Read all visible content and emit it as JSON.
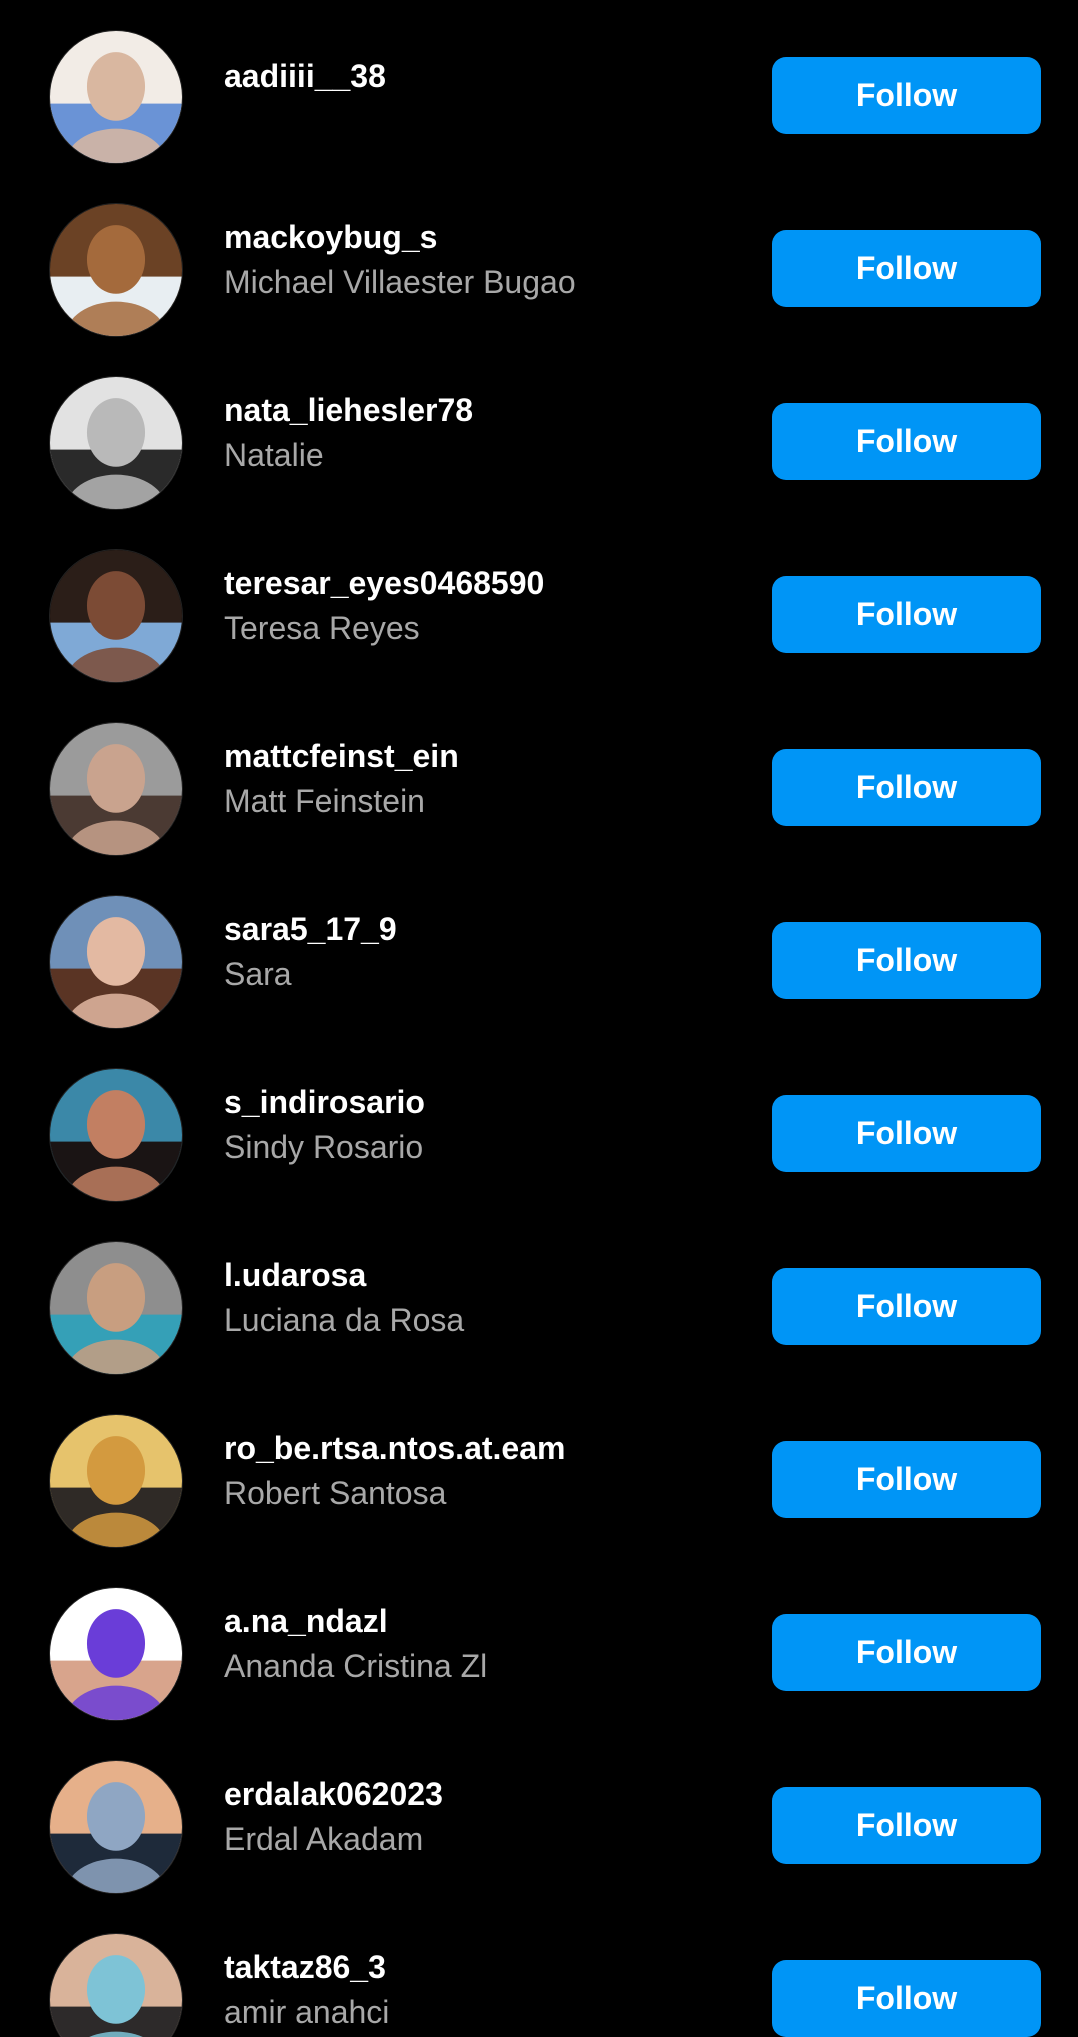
{
  "colors": {
    "background": "#000000",
    "follow_button": "#0095f6",
    "username": "#ffffff",
    "fullname": "#a8a8a8"
  },
  "accounts": [
    {
      "username": "aadiiii__38",
      "fullname": "",
      "follow_label": "Follow",
      "avatar_colors": [
        "#d9b7a0",
        "#6a93d6",
        "#f2ece6"
      ]
    },
    {
      "username": "mackoybug_s",
      "fullname": "Michael Villaester Bugao",
      "follow_label": "Follow",
      "avatar_colors": [
        "#a46a3c",
        "#e8eef2",
        "#6b4225"
      ]
    },
    {
      "username": "nata_liehesler78",
      "fullname": "Natalie",
      "follow_label": "Follow",
      "avatar_colors": [
        "#b9b9b9",
        "#2a2a2a",
        "#e2e2e2"
      ]
    },
    {
      "username": "teresar_eyes0468590",
      "fullname": "Teresa Reyes",
      "follow_label": "Follow",
      "avatar_colors": [
        "#7c4b35",
        "#7fa9d6",
        "#2b1e18"
      ]
    },
    {
      "username": "mattcfeinst_ein",
      "fullname": "Matt Feinstein",
      "follow_label": "Follow",
      "avatar_colors": [
        "#c9a38e",
        "#4b3a33",
        "#9b9b9b"
      ]
    },
    {
      "username": "sara5_17_9",
      "fullname": "Sara",
      "follow_label": "Follow",
      "avatar_colors": [
        "#e3b9a2",
        "#5a3424",
        "#6f90b8"
      ]
    },
    {
      "username": "s_indirosario",
      "fullname": "Sindy Rosario",
      "follow_label": "Follow",
      "avatar_colors": [
        "#c27f62",
        "#1a1414",
        "#3b88a8"
      ]
    },
    {
      "username": "l.udarosa",
      "fullname": "Luciana da Rosa",
      "follow_label": "Follow",
      "avatar_colors": [
        "#c89e80",
        "#35a0b7",
        "#8e8e8e"
      ]
    },
    {
      "username": "ro_be.rtsa.ntos.at.eam",
      "fullname": "Robert Santosa",
      "follow_label": "Follow",
      "avatar_colors": [
        "#d39a3f",
        "#2f2a26",
        "#e6c36c"
      ]
    },
    {
      "username": "a.na_ndazl",
      "fullname": "Ananda Cristina Zl",
      "follow_label": "Follow",
      "avatar_colors": [
        "#6a3dd8",
        "#d8a48c",
        "#ffffff"
      ]
    },
    {
      "username": "erdalak062023",
      "fullname": "Erdal Akadam",
      "follow_label": "Follow",
      "avatar_colors": [
        "#8fa6c3",
        "#1e2a3a",
        "#e6b08a"
      ]
    },
    {
      "username": "taktaz86_3",
      "fullname": "amir anahci",
      "follow_label": "Follow",
      "avatar_colors": [
        "#7ec3d6",
        "#2d2a2a",
        "#d9b39a"
      ]
    }
  ]
}
